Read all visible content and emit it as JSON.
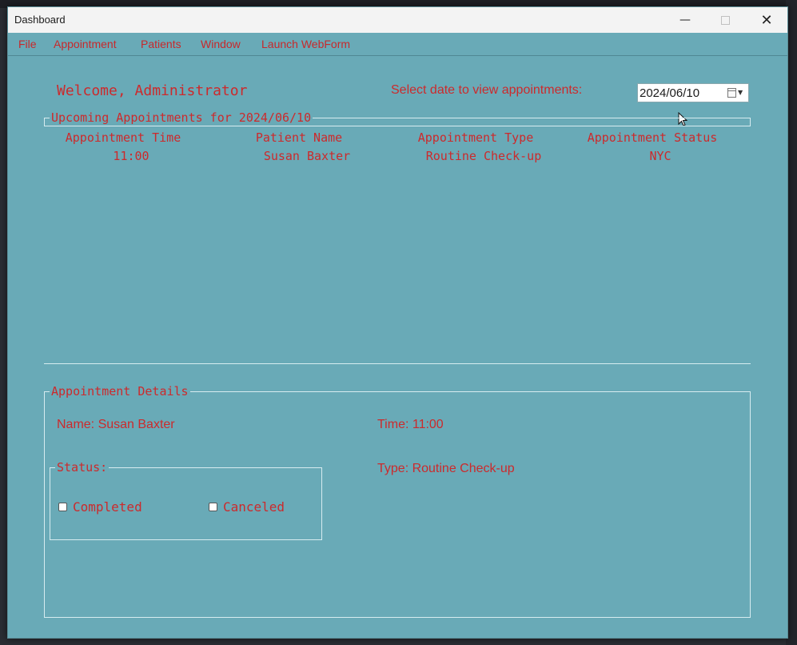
{
  "window": {
    "title": "Dashboard",
    "controls": {
      "minimize": "—",
      "close": "✕"
    }
  },
  "menu": {
    "items": [
      "File",
      "Appointment",
      "Patients",
      "Window",
      "Launch WebForm"
    ]
  },
  "header": {
    "welcome": "Welcome, Administrator",
    "select_date_label": "Select date to view appointments:",
    "date_value": "2024/06/10"
  },
  "upcoming": {
    "legend": "Upcoming Appointments for 2024/06/10",
    "columns": [
      "Appointment Time",
      "Patient Name",
      "Appointment Type",
      "Appointment Status"
    ],
    "rows": [
      [
        "11:00",
        "Susan Baxter",
        "Routine Check-up",
        "NYC"
      ]
    ]
  },
  "details": {
    "legend": "Appointment Details",
    "name": "Name: Susan Baxter",
    "time": "Time: 11:00",
    "type": "Type: Routine Check-up",
    "status": {
      "legend": "Status:",
      "completed_label": "Completed",
      "completed_checked": false,
      "canceled_label": "Canceled",
      "canceled_checked": false
    }
  },
  "colors": {
    "background": "#69aab7",
    "text_accent": "#cc2a2c",
    "group_border": "#d7ecf0"
  }
}
